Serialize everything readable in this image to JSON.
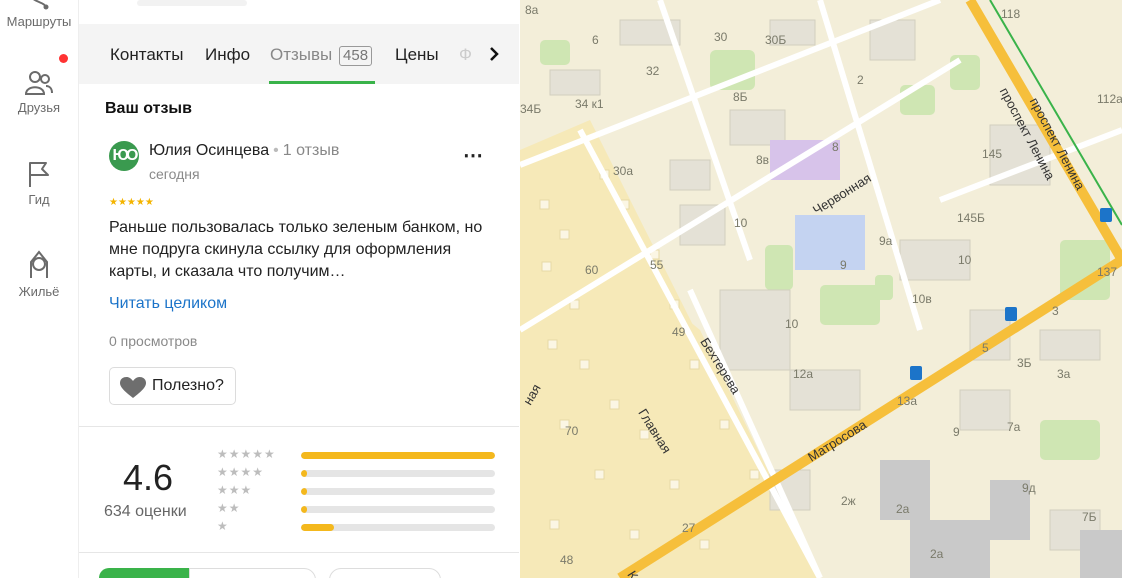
{
  "rail": {
    "items": [
      {
        "label": "Маршруты",
        "icon": "route-icon"
      },
      {
        "label": "Друзья",
        "icon": "friends-icon"
      },
      {
        "label": "Гид",
        "icon": "flag-icon"
      },
      {
        "label": "Жильё",
        "icon": "house-icon"
      }
    ]
  },
  "tabs": {
    "contacts": "Контакты",
    "info": "Инфо",
    "reviews": "Отзывы",
    "reviews_count": "458",
    "prices": "Цены",
    "faded": "Ф"
  },
  "review": {
    "section_title": "Ваш отзыв",
    "avatar_initials": "ЮО",
    "author": "Юлия Осинцева",
    "author_reviews": "1 отзыв",
    "date": "сегодня",
    "stars": "★★★★★",
    "text": "Раньше пользовалась только зеленым банком, но мне подруга скинула ссылку для оформления карты, и сказала что получим…",
    "read_more": "Читать целиком",
    "views": "0 просмотров",
    "useful_label": "Полезно?"
  },
  "rating": {
    "value": "4.6",
    "count_label": "634 оценки",
    "distribution": [
      {
        "stars": "★★★★★",
        "fraction": 1.0
      },
      {
        "stars": "★★★★",
        "fraction": 0.03
      },
      {
        "stars": "★★★",
        "fraction": 0.03
      },
      {
        "stars": "★★",
        "fraction": 0.03
      },
      {
        "stars": "★",
        "fraction": 0.17
      }
    ]
  },
  "map": {
    "labels": [
      "8а",
      "6",
      "30",
      "30Б",
      "118",
      "32",
      "2",
      "34Б",
      "34 к1",
      "8Б",
      "145",
      "112а",
      "30а",
      "8",
      "8в",
      "10",
      "145Б",
      "9а",
      "10",
      "137",
      "60",
      "55",
      "9",
      "10в",
      "3",
      "49",
      "10",
      "5",
      "3Б",
      "12а",
      "3а",
      "13а",
      "9",
      "7а",
      "70",
      "9д",
      "2ж",
      "2а",
      "27",
      "7Б",
      "48",
      "2а"
    ],
    "streets": [
      "проспект Ленина",
      "проспект Ленина",
      "Червонная",
      "Бехтерева",
      "Матросова",
      "Главная",
      "Ко",
      "ная"
    ],
    "colors": {
      "road_major": "#f6bf3b",
      "road_minor": "#ffffff",
      "park": "#cfe6b3",
      "residential": "#f3eed9",
      "private_sector": "#f6e9b8",
      "building": "#e4e1d6",
      "school": "#d7c3ea",
      "blue_building": "#c4d3f1",
      "industrial": "#c9c9c9"
    }
  }
}
